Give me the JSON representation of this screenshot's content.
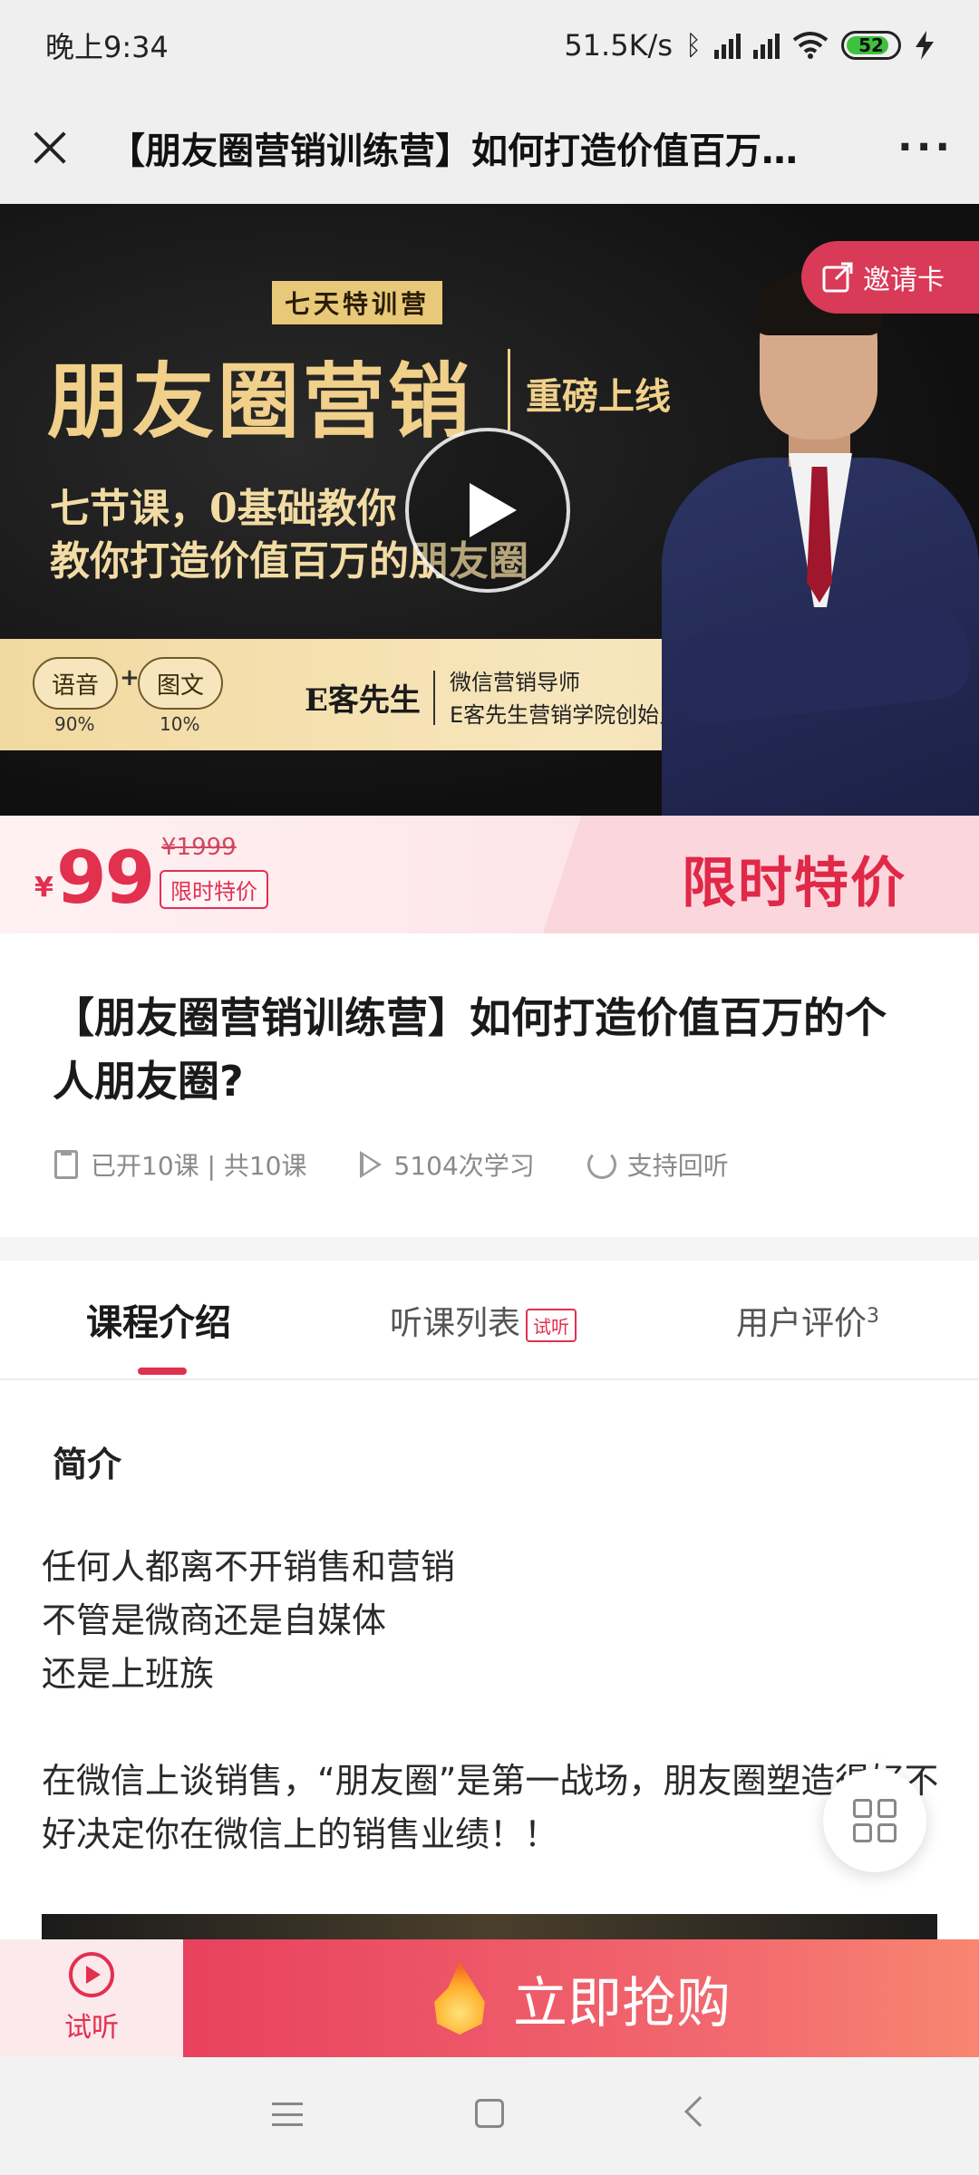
{
  "status": {
    "time": "晚上9:34",
    "net_speed": "51.5K/s",
    "battery": "52"
  },
  "titlebar": {
    "title": "【朋友圈营销训练营】如何打造价值百万…"
  },
  "banner": {
    "sub_label": "七天特训营",
    "main_title": "朋友圈营销",
    "sub_title": "重磅上线",
    "line1": "七节课，0基础教你",
    "line2": "教你打造价值百万的朋友圈",
    "pill_a": "语音",
    "pill_b": "图文",
    "pct_a": "90%",
    "pct_b": "10%",
    "teacher": "E客先生",
    "role1": "微信营销导师",
    "role2": "E客先生营销学院创始人",
    "invite_label": "邀请卡"
  },
  "price": {
    "currency": "¥",
    "current": "99",
    "original": "¥1999",
    "badge": "限时特价",
    "promo": "限时特价"
  },
  "course": {
    "title": "【朋友圈营销训练营】如何打造价值百万的个人朋友圈?",
    "lessons": "已开10课 | 共10课",
    "plays": "5104次学习",
    "replay": "支持回听"
  },
  "tabs": {
    "intro": "课程介绍",
    "list": "听课列表",
    "list_badge": "试听",
    "review": "用户评价",
    "review_count": "3"
  },
  "intro": {
    "heading": "简介",
    "p1": "任何人都离不开销售和营销",
    "p2": "不管是微商还是自媒体",
    "p3": "还是上班族",
    "p4": "在微信上谈销售，“朋友圈”是第一战场，朋友圈塑造得好不好决定你在微信上的销售业绩！！"
  },
  "actions": {
    "trial": "试听",
    "buy": "立即抢购"
  },
  "colors": {
    "accent": "#e2304f",
    "banner_gold": "#f0d08a"
  }
}
